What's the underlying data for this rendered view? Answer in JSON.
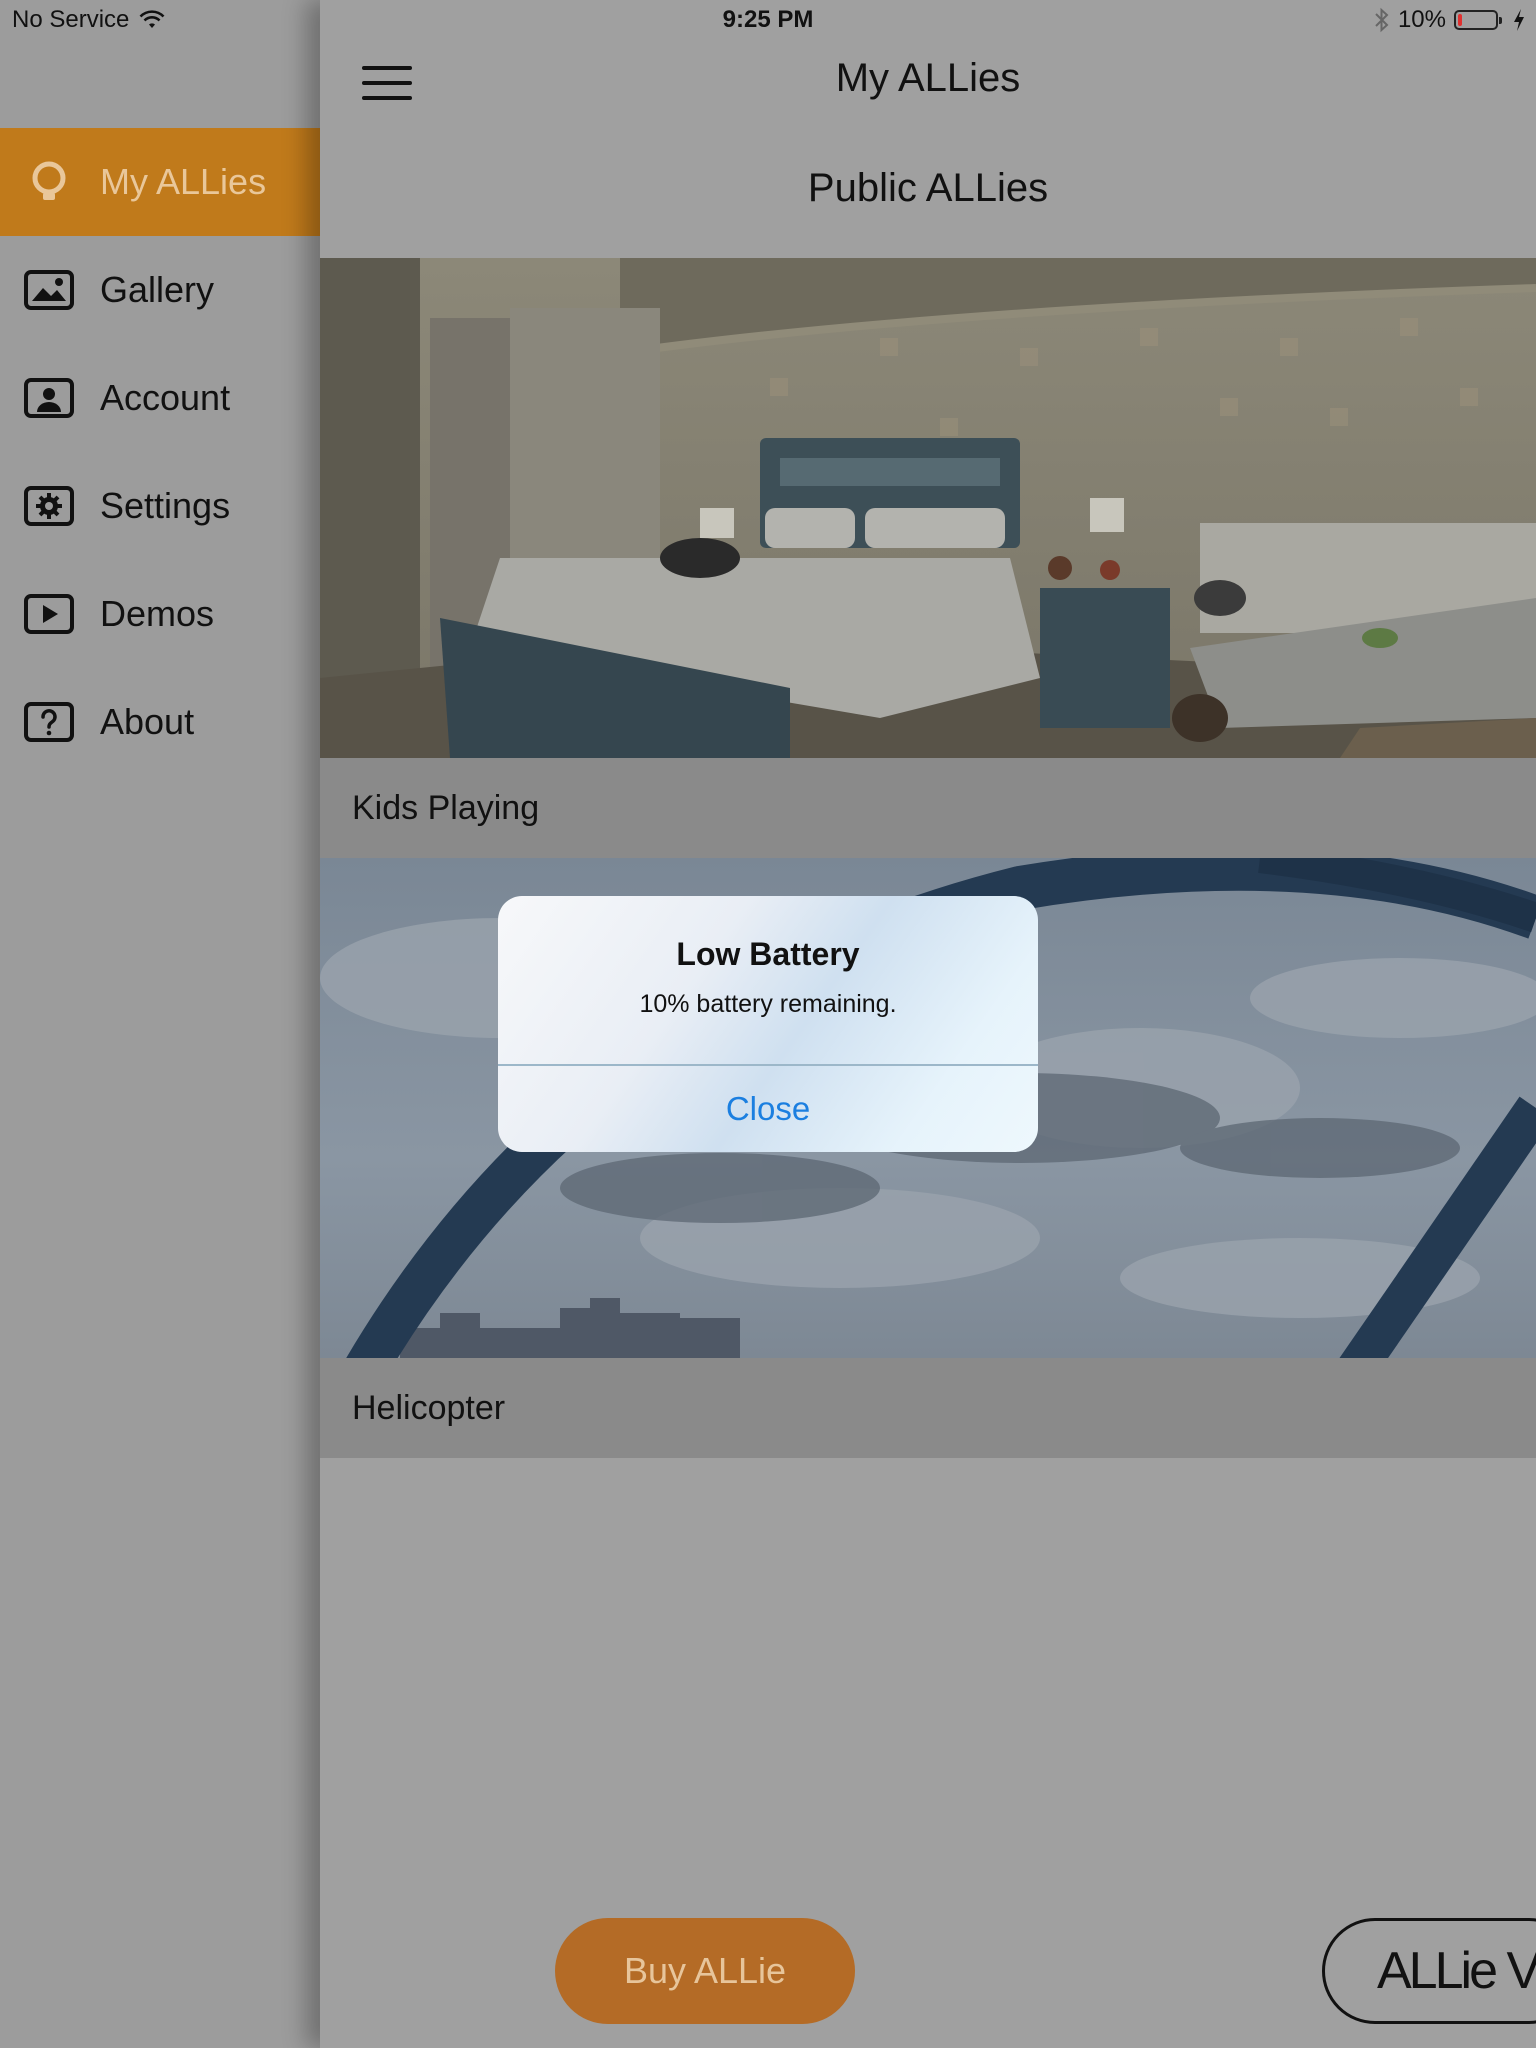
{
  "status_bar": {
    "carrier": "No Service",
    "time": "9:25 PM",
    "battery_percent": "10%",
    "battery_level": 0.1
  },
  "sidebar": {
    "items": [
      {
        "label": "My ALLies",
        "icon": "bulb-icon"
      },
      {
        "label": "Gallery",
        "icon": "image-icon"
      },
      {
        "label": "Account",
        "icon": "account-icon"
      },
      {
        "label": "Settings",
        "icon": "gear-icon"
      },
      {
        "label": "Demos",
        "icon": "play-icon"
      },
      {
        "label": "About",
        "icon": "question-icon"
      }
    ],
    "active_color": "#c07a1b"
  },
  "header": {
    "title": "My ALLies",
    "subtitle": "Public ALLies"
  },
  "cards": [
    {
      "caption": "Kids Playing"
    },
    {
      "caption": "Helicopter"
    }
  ],
  "buttons": {
    "buy": "Buy  ALLie",
    "viewer": "ALLie V"
  },
  "alert": {
    "title": "Low Battery",
    "message": "10% battery remaining.",
    "button": "Close",
    "button_color": "#1b7fe0"
  }
}
